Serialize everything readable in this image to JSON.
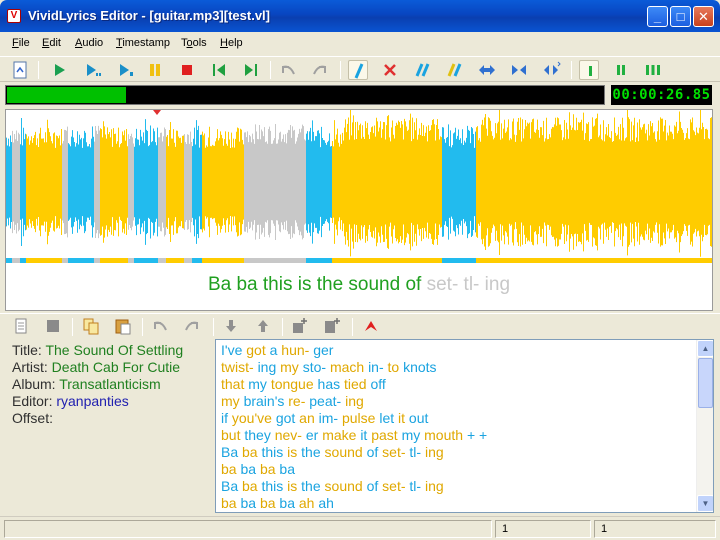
{
  "window": {
    "title": "VividLyrics Editor - [guitar.mp3][test.vl]",
    "app_icon": "V",
    "buttons": {
      "minimize": "_",
      "maximize": "□",
      "close": "✕"
    }
  },
  "menu": [
    {
      "label": "File",
      "underline": "F"
    },
    {
      "label": "Edit",
      "underline": "E"
    },
    {
      "label": "Audio",
      "underline": "A"
    },
    {
      "label": "Timestamp",
      "underline": "T"
    },
    {
      "label": "Tools",
      "underline": "o"
    },
    {
      "label": "Help",
      "underline": "H"
    }
  ],
  "toolbar": {
    "icons": [
      "new-file-icon",
      "play-icon",
      "play-from-icon",
      "play-to-icon",
      "pause-icon",
      "stop-icon",
      "prev-mark-icon",
      "next-mark-icon",
      "undo-icon",
      "redo-icon",
      "timestamp-pen-icon",
      "delete-timestamp-icon",
      "timestamp-multi-icon",
      "timestamp-multi-alt-icon",
      "stretch-icon",
      "shrink-icon",
      "stretch-all-icon",
      "zoom-1-icon",
      "zoom-2-icon",
      "zoom-3-icon"
    ]
  },
  "playback": {
    "progress": 0.2,
    "time": "00:00:26.85",
    "colors": {
      "progress": "#00c000",
      "time": "#00e000"
    }
  },
  "waveform": {
    "colors": {
      "sung": "#ffcc00",
      "current": "#22bbee",
      "gap": "#c8c8c8"
    }
  },
  "lyric_display": {
    "sung": "Ba ba this is the sound of",
    "unsung": "set- tl- ing"
  },
  "toolbar2": {
    "icons": [
      "document-icon",
      "stop-square-icon",
      "copy-icon",
      "paste-icon",
      "undo-icon",
      "redo-icon",
      "move-down-icon",
      "move-up-icon",
      "insert-before-icon",
      "insert-after-icon",
      "marker-icon"
    ]
  },
  "info": {
    "title_label": "Title:",
    "title": "The Sound Of Settling",
    "artist_label": "Artist:",
    "artist": "Death Cab For Cutie",
    "album_label": "Album:",
    "album": "Transatlanticism",
    "editor_label": "Editor:",
    "editor": "ryanpanties",
    "offset_label": "Offset:",
    "offset": ""
  },
  "lyrics": [
    [
      [
        "I've ",
        "b"
      ],
      [
        "got ",
        "g"
      ],
      [
        "a ",
        "b"
      ],
      [
        "hun- ",
        "g"
      ],
      [
        "ger",
        "b"
      ]
    ],
    [
      [
        "twist- ",
        "g"
      ],
      [
        "ing ",
        "b"
      ],
      [
        "my ",
        "g"
      ],
      [
        "sto- ",
        "b"
      ],
      [
        "mach ",
        "g"
      ],
      [
        "in- ",
        "b"
      ],
      [
        "to ",
        "g"
      ],
      [
        "knots",
        "b"
      ]
    ],
    [
      [
        "that ",
        "g"
      ],
      [
        "my ",
        "b"
      ],
      [
        "tongue ",
        "g"
      ],
      [
        "has ",
        "b"
      ],
      [
        "tied ",
        "g"
      ],
      [
        "off",
        "b"
      ]
    ],
    [
      [
        "my ",
        "g"
      ],
      [
        "brain's ",
        "b"
      ],
      [
        "re- ",
        "g"
      ],
      [
        "peat- ",
        "b"
      ],
      [
        "ing",
        "g"
      ]
    ],
    [
      [
        "if ",
        "b"
      ],
      [
        "you've ",
        "g"
      ],
      [
        "got ",
        "b"
      ],
      [
        "an ",
        "g"
      ],
      [
        "im- ",
        "b"
      ],
      [
        "pulse ",
        "g"
      ],
      [
        "let ",
        "b"
      ],
      [
        "it ",
        "g"
      ],
      [
        "out",
        "b"
      ]
    ],
    [
      [
        "but ",
        "g"
      ],
      [
        "they ",
        "b"
      ],
      [
        "nev- ",
        "g"
      ],
      [
        "er ",
        "b"
      ],
      [
        "make ",
        "g"
      ],
      [
        "it ",
        "b"
      ],
      [
        "past ",
        "g"
      ],
      [
        "my ",
        "b"
      ],
      [
        "mouth ",
        "g"
      ],
      [
        "+ ",
        "b"
      ],
      [
        "+",
        "b"
      ]
    ],
    [
      [
        "Ba ",
        "b"
      ],
      [
        "ba ",
        "g"
      ],
      [
        "this ",
        "b"
      ],
      [
        "is ",
        "g"
      ],
      [
        "the ",
        "b"
      ],
      [
        "sound ",
        "g"
      ],
      [
        "of ",
        "b"
      ],
      [
        "set- ",
        "g"
      ],
      [
        "tl- ",
        "b"
      ],
      [
        "ing",
        "g"
      ]
    ],
    [
      [
        "ba ",
        "g"
      ],
      [
        "ba ",
        "b"
      ],
      [
        "ba ",
        "g"
      ],
      [
        "ba",
        "b"
      ]
    ],
    [
      [
        "Ba ",
        "b"
      ],
      [
        "ba ",
        "g"
      ],
      [
        "this ",
        "b"
      ],
      [
        "is ",
        "g"
      ],
      [
        "the ",
        "b"
      ],
      [
        "sound ",
        "g"
      ],
      [
        "of ",
        "b"
      ],
      [
        "set- ",
        "g"
      ],
      [
        "tl- ",
        "b"
      ],
      [
        "ing",
        "g"
      ]
    ],
    [
      [
        "ba ",
        "g"
      ],
      [
        "ba ",
        "b"
      ],
      [
        "ba ",
        "g"
      ],
      [
        "ba ",
        "b"
      ],
      [
        "ah ",
        "g"
      ],
      [
        "ah",
        "b"
      ]
    ]
  ],
  "status": {
    "pane2": "1",
    "pane3": "1"
  }
}
